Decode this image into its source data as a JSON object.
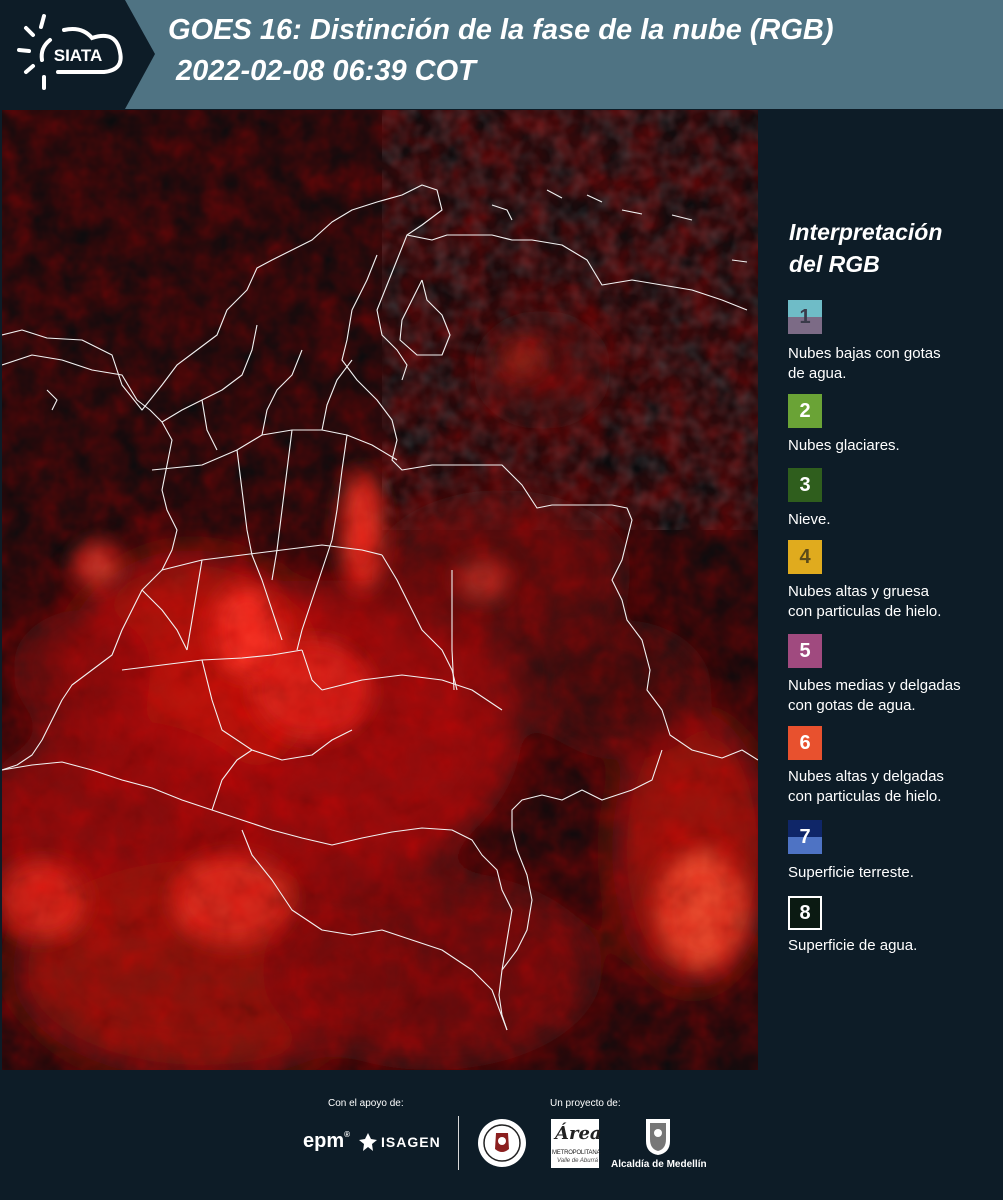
{
  "header": {
    "brand": "SIATA",
    "title_line1": "GOES 16: Distinción de la fase de la nube (RGB)",
    "title_line2": "2022-02-08 06:39 COT"
  },
  "legend": {
    "title_line1": "Interpretación",
    "title_line2": "del RGB",
    "items": [
      {
        "number": "1",
        "label_lines": [
          "Nubes bajas con gotas",
          "de agua."
        ],
        "color_top": "#6fbcc7",
        "color_bottom": "#7c6b86"
      },
      {
        "number": "2",
        "label_lines": [
          "Nubes glaciares."
        ],
        "color": "#6aa336"
      },
      {
        "number": "3",
        "label_lines": [
          "Nieve."
        ],
        "color": "#2f5e1d"
      },
      {
        "number": "4",
        "label_lines": [
          "Nubes altas y gruesa",
          "con particulas de hielo."
        ],
        "color": "#e0ab1e"
      },
      {
        "number": "5",
        "label_lines": [
          "Nubes medias y delgadas",
          "con gotas de agua."
        ],
        "color": "#a04a7f"
      },
      {
        "number": "6",
        "label_lines": [
          "Nubes altas y delgadas",
          "con particulas de hielo."
        ],
        "color": "#e8512e"
      },
      {
        "number": "7",
        "label_lines": [
          "Superficie terreste."
        ],
        "color_top": "#0f2668",
        "color_bottom": "#4e73c4"
      },
      {
        "number": "8",
        "label_lines": [
          "Superficie de agua."
        ],
        "color": "#0b1a12"
      }
    ]
  },
  "footer": {
    "support_caption": "Con el apoyo de:",
    "project_caption": "Un proyecto de:",
    "sponsor_1": "epm",
    "sponsor_2": "ISAGEN",
    "partner_area_1": "Área",
    "partner_area_2": "METROPOLITANA",
    "partner_area_3": "Valle de Aburrá",
    "partner_alcaldia": "Alcaldía de Medellín"
  }
}
